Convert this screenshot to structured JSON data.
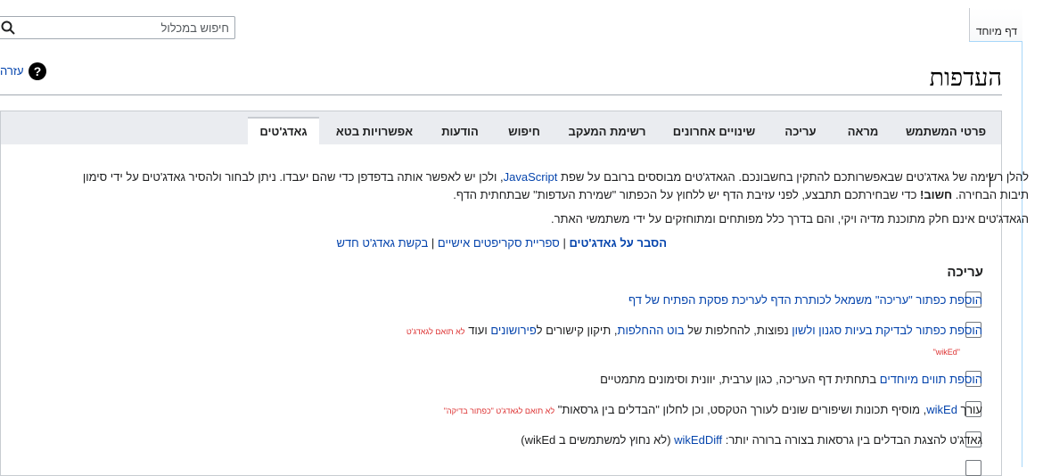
{
  "special_tab": {
    "label": "דף מיוחד"
  },
  "search": {
    "placeholder": "חיפוש במכלול"
  },
  "help": {
    "label": "עזרה",
    "icon": "?"
  },
  "page": {
    "title": "העדפות"
  },
  "tabs": [
    {
      "label": "פרטי המשתמש",
      "active": false
    },
    {
      "label": "מראה",
      "active": false
    },
    {
      "label": "עריכה",
      "active": false
    },
    {
      "label": "שינויים אחרונים",
      "active": false
    },
    {
      "label": "רשימת המעקב",
      "active": false
    },
    {
      "label": "חיפוש",
      "active": false
    },
    {
      "label": "הודעות",
      "active": false
    },
    {
      "label": "אפשרויות בטא",
      "active": false
    },
    {
      "label": "גאדג'טים",
      "active": true
    }
  ],
  "intro": {
    "line1_before": "להלן רשימה של גאדג'טים שבאפשרותכם להתקין בחשבונכם. הגאדג'טים מבוססים ברובם על שפת ",
    "line1_link": "JavaScript",
    "line1_after": ", ולכן יש לאפשר אותה בדפדפן כדי שהם יעבדו. ניתן לבחור ולהסיר גאדג'טים על ידי סימון",
    "line2_before": "תיבות הבחירה. ",
    "line2_bold": "חשוב!",
    "line2_after": " כדי שבחירתכם תתבצע, לפני עזיבת הדף יש ללחוץ על הכפתור \"שמירת העדפות\" שבתחתית הדף.",
    "line3": "הגאדג'טים אינם חלק מתוכנת מדיה ויקי, והם בדרך כלל מפותחים ומתוחזקים על ידי משתמשי האתר.",
    "links": {
      "explain": "הסבר על גאדג'טים",
      "sep1": " | ",
      "scripts": "ספריית סקריפטים אישיים",
      "sep2": " | ",
      "request": "בקשת גאדג'ט חדש"
    }
  },
  "section": {
    "title": "עריכה"
  },
  "gadgets": [
    {
      "link": "הוספת כפתור \"עריכה\" משמאל לכותרת הדף לעריכת פסקת הפתיח של דף"
    },
    {
      "link": "הוספת כפתור לבדיקת בעיות סגנון ולשון",
      "text1": " נפוצות, להחלפות של ",
      "link2": "בוט ההחלפות",
      "text2": ", תיקון קישורים ל",
      "link3": "פירושונים",
      "text3": " ועוד ",
      "note1": "לא תואם לגאדג'ט",
      "note2": "\"wikEd\""
    },
    {
      "link": "הוספת תווים מיוחדים",
      "text1": " בתחתית דף העריכה, כגון ערבית, יוונית וסימונים מתמטיים"
    },
    {
      "text0": "עורך ",
      "link": "wikEd",
      "text1": ", מוסיף תכונות ושיפורים שונים לעורך הטקסט, וכן לחלון \"הבדלים בין גרסאות\" ",
      "note1": "לא תואם לגאדג'ט \"כפתור בדיקה\""
    },
    {
      "text0": "גאדג'ט להצגת הבדלים בין גרסאות בצורה ברורה יותר: ",
      "link": "wikEdDiff",
      "text1": " (לא נחוץ למשתמשים ב wikEd)"
    }
  ]
}
